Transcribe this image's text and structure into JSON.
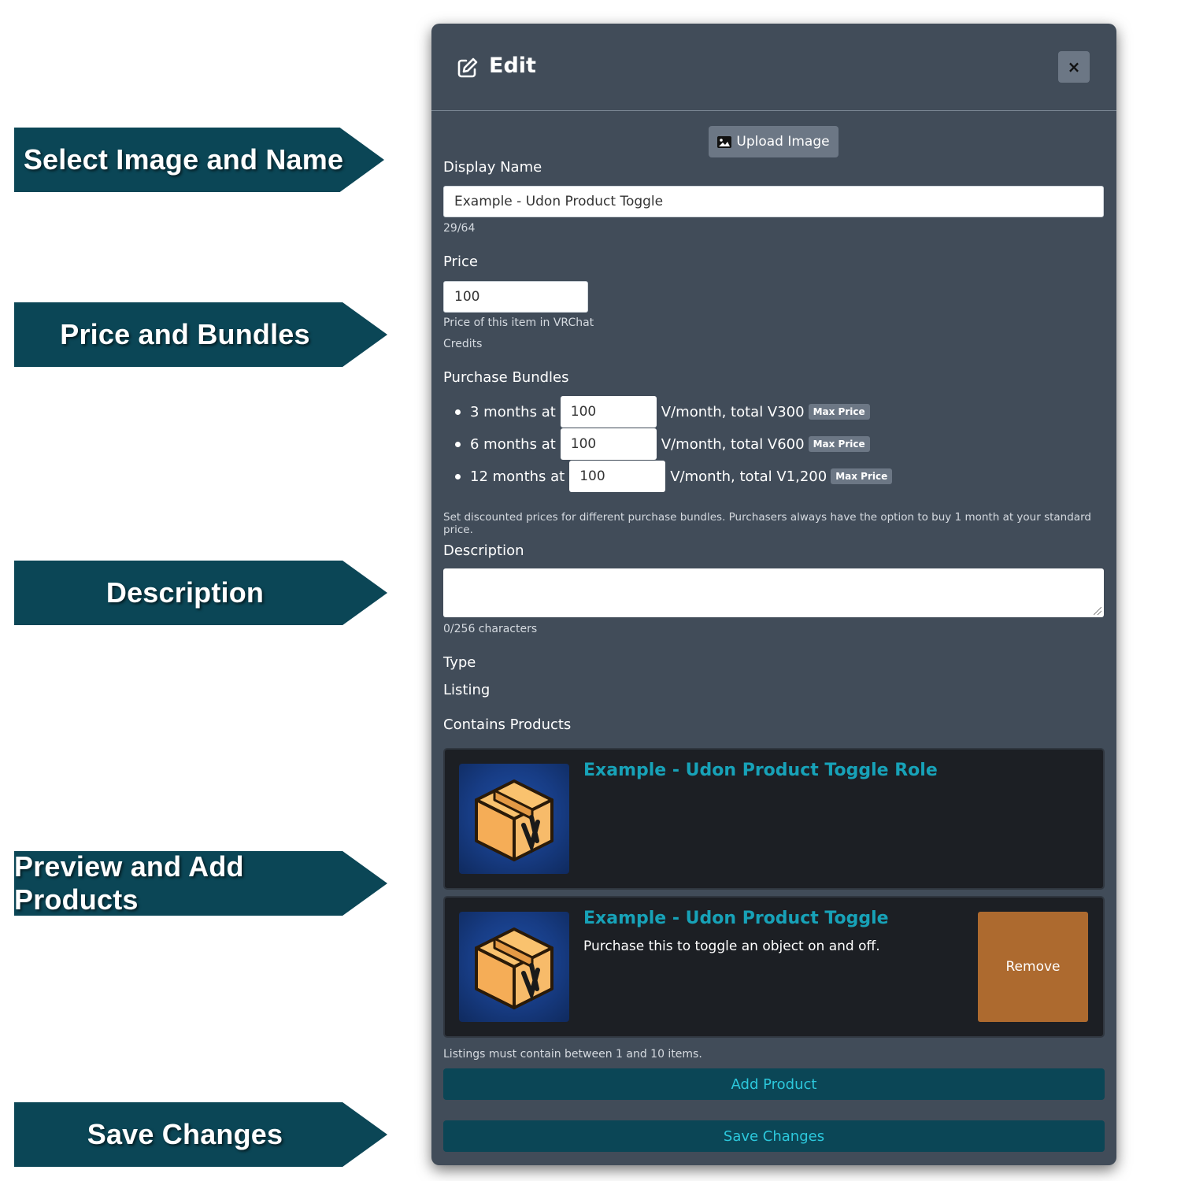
{
  "callouts": [
    "Select Image and Name",
    "Price and Bundles",
    "Description",
    "Preview and Add Products",
    "Save Changes"
  ],
  "modal": {
    "title": "Edit",
    "close_label": "×",
    "upload_label": "Upload Image",
    "display_name": {
      "label": "Display Name",
      "value": "Example - Udon Product Toggle",
      "counter": "29/64"
    },
    "price": {
      "label": "Price",
      "value": "100",
      "help_line1": "Price of this item in VRChat",
      "help_line2": "Credits"
    },
    "bundles": {
      "label": "Purchase Bundles",
      "rows": [
        {
          "prefix": "3 months at",
          "value": "100",
          "suffix": "V/month, total V300",
          "badge": "Max Price"
        },
        {
          "prefix": "6 months at",
          "value": "100",
          "suffix": "V/month, total V600",
          "badge": "Max Price"
        },
        {
          "prefix": "12 months at",
          "value": "100",
          "suffix": "V/month, total V1,200",
          "badge": "Max Price"
        }
      ],
      "help": "Set discounted prices for different purchase bundles. Purchasers always have the option to buy 1 month at your standard price."
    },
    "description": {
      "label": "Description",
      "value": "",
      "counter": "0/256 characters"
    },
    "type": {
      "label": "Type",
      "value": "Listing"
    },
    "products": {
      "label": "Contains Products",
      "items": [
        {
          "title": "Example - Udon Product Toggle Role",
          "desc": ""
        },
        {
          "title": "Example - Udon Product Toggle",
          "desc": "Purchase this to toggle an object on and off.",
          "remove": "Remove"
        }
      ],
      "help": "Listings must contain between 1 and 10 items."
    },
    "add_product": "Add Product",
    "save_changes": "Save Changes"
  },
  "colors": {
    "callout": "#0b4656",
    "modal_bg": "#414c59",
    "accent": "#17a2b8",
    "remove": "#ad6a2f",
    "button_teal": "#0b4656"
  }
}
